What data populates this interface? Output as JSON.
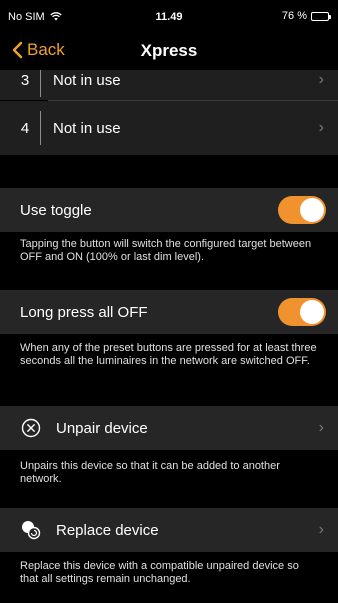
{
  "status": {
    "carrier": "No SIM",
    "time": "11.49",
    "battery": "76 %",
    "battery_level": 0.76
  },
  "nav": {
    "back_label": "Back",
    "title": "Xpress"
  },
  "presets": [
    {
      "num": "3",
      "label": "Not in use"
    },
    {
      "num": "4",
      "label": "Not in use"
    }
  ],
  "use_toggle": {
    "label": "Use toggle",
    "on": true,
    "description": "Tapping the button will switch the configured target between OFF and ON (100% or last dim level)."
  },
  "long_press": {
    "label": "Long press all OFF",
    "on": true,
    "description": "When any of the preset buttons are pressed for at least three seconds all the luminaires in the network are switched OFF."
  },
  "unpair": {
    "label": "Unpair device",
    "description": "Unpairs this device so that it can be added to another network."
  },
  "replace": {
    "label": "Replace device",
    "description": "Replace this device with a compatible unpaired device so that all settings remain unchanged."
  },
  "colors": {
    "accent": "#f0932e",
    "back": "#f0a030",
    "row_bg": "#262626"
  }
}
